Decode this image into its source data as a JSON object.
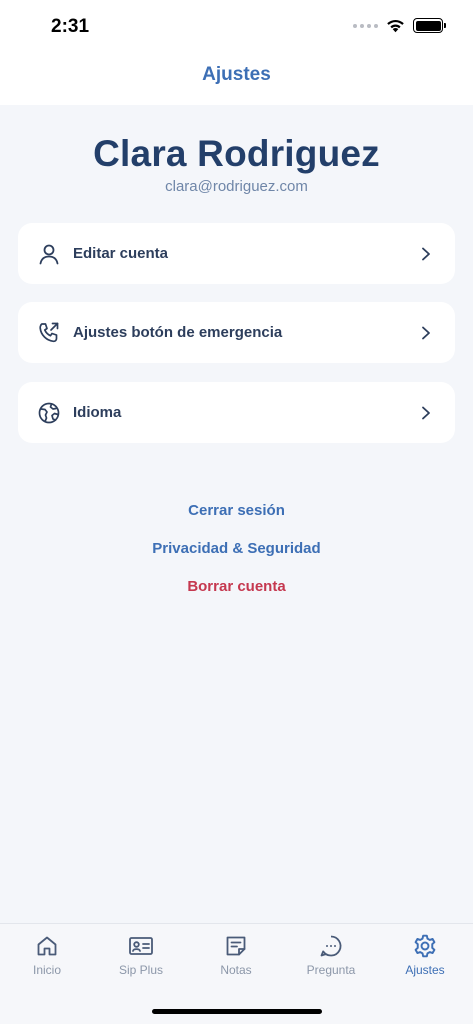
{
  "status_bar": {
    "time": "2:31"
  },
  "header": {
    "title": "Ajustes"
  },
  "profile": {
    "name": "Clara Rodriguez",
    "email": "clara@rodriguez.com"
  },
  "settings_items": [
    {
      "label": "Editar cuenta",
      "icon": "user-icon"
    },
    {
      "label": "Ajustes botón de emergencia",
      "icon": "phone-outgoing-icon"
    },
    {
      "label": "Idioma",
      "icon": "globe-icon"
    }
  ],
  "links": {
    "logout": "Cerrar sesión",
    "privacy": "Privacidad & Seguridad",
    "delete": "Borrar cuenta"
  },
  "tabs": [
    {
      "label": "Inicio",
      "icon": "home-icon",
      "active": false
    },
    {
      "label": "Sip Plus",
      "icon": "id-card-icon",
      "active": false
    },
    {
      "label": "Notas",
      "icon": "notes-icon",
      "active": false
    },
    {
      "label": "Pregunta",
      "icon": "chat-bubble-icon",
      "active": false
    },
    {
      "label": "Ajustes",
      "icon": "gear-icon",
      "active": true
    }
  ],
  "colors": {
    "accent": "#3d6fb5",
    "title": "#233f6a",
    "danger": "#c5384f",
    "background": "#f4f6fa",
    "tab_inactive": "#8c97a9"
  }
}
